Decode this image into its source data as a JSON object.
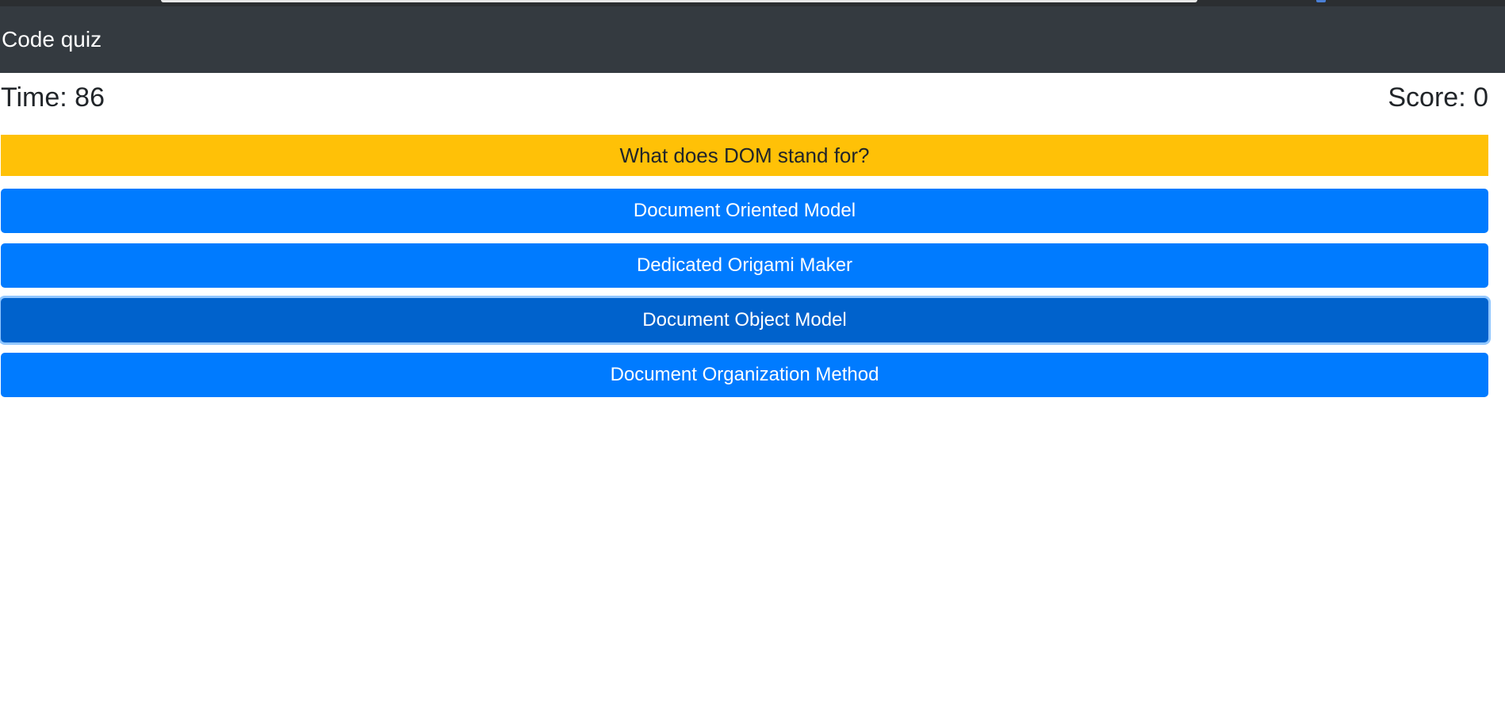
{
  "app": {
    "title": "Code quiz"
  },
  "stats": {
    "time_label": "Time: 86",
    "score_label": "Score: 0"
  },
  "question": {
    "text": "What does DOM stand for?"
  },
  "answers": [
    {
      "label": "Document Oriented Model"
    },
    {
      "label": "Dedicated Origami Maker"
    },
    {
      "label": "Document Object Model"
    },
    {
      "label": "Document Organization Method"
    }
  ],
  "colors": {
    "navbar": "#343a40",
    "question_bg": "#ffc107",
    "answer_bg": "#007bff",
    "answer_focused_bg": "#0062cc"
  }
}
